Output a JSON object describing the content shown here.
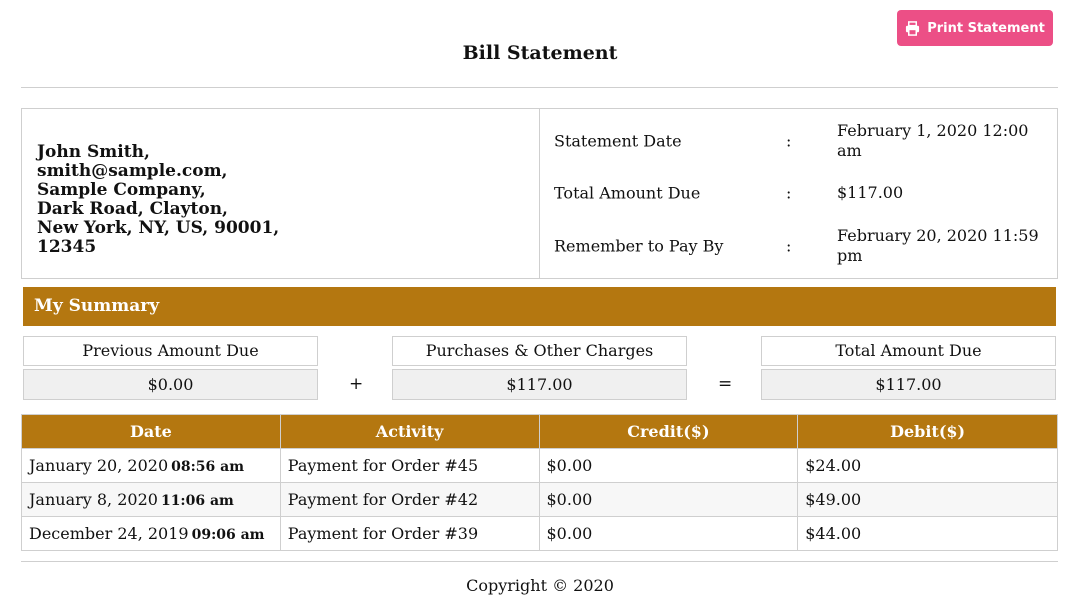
{
  "header": {
    "title": "Bill Statement",
    "print_button": "Print Statement",
    "print_icon": "printer-icon",
    "accent": "#ec4f86"
  },
  "customer": {
    "lines": [
      "John Smith,",
      "smith@sample.com,",
      "Sample Company,",
      "Dark Road, Clayton,",
      "New York, NY, US, 90001,",
      "12345"
    ]
  },
  "statement": {
    "rows": [
      {
        "label": "Statement Date",
        "colon": ":",
        "value": "February 1, 2020 12:00 am"
      },
      {
        "label": "Total Amount Due",
        "colon": ":",
        "value": "$117.00"
      },
      {
        "label": "Remember to Pay By",
        "colon": ":",
        "value": "February 20, 2020 11:59 pm"
      }
    ]
  },
  "summary": {
    "title": "My Summary",
    "bar_color": "#b47710",
    "previous": {
      "label": "Previous Amount Due",
      "value": "$0.00"
    },
    "plus": "+",
    "purchases": {
      "label": "Purchases & Other Charges",
      "value": "$117.00"
    },
    "equals": "=",
    "total": {
      "label": "Total Amount Due",
      "value": "$117.00"
    }
  },
  "activity": {
    "columns": [
      "Date",
      "Activity",
      "Credit($)",
      "Debit($)"
    ],
    "rows": [
      {
        "date": "January 20, 2020",
        "time": "08:56 am",
        "activity": "Payment for Order #45",
        "credit": "$0.00",
        "debit": "$24.00"
      },
      {
        "date": "January 8, 2020",
        "time": "11:06 am",
        "activity": "Payment for Order #42",
        "credit": "$0.00",
        "debit": "$49.00"
      },
      {
        "date": "December 24, 2019",
        "time": "09:06 am",
        "activity": "Payment for Order #39",
        "credit": "$0.00",
        "debit": "$44.00"
      }
    ]
  },
  "footer": {
    "copyright": "Copyright © 2020"
  }
}
